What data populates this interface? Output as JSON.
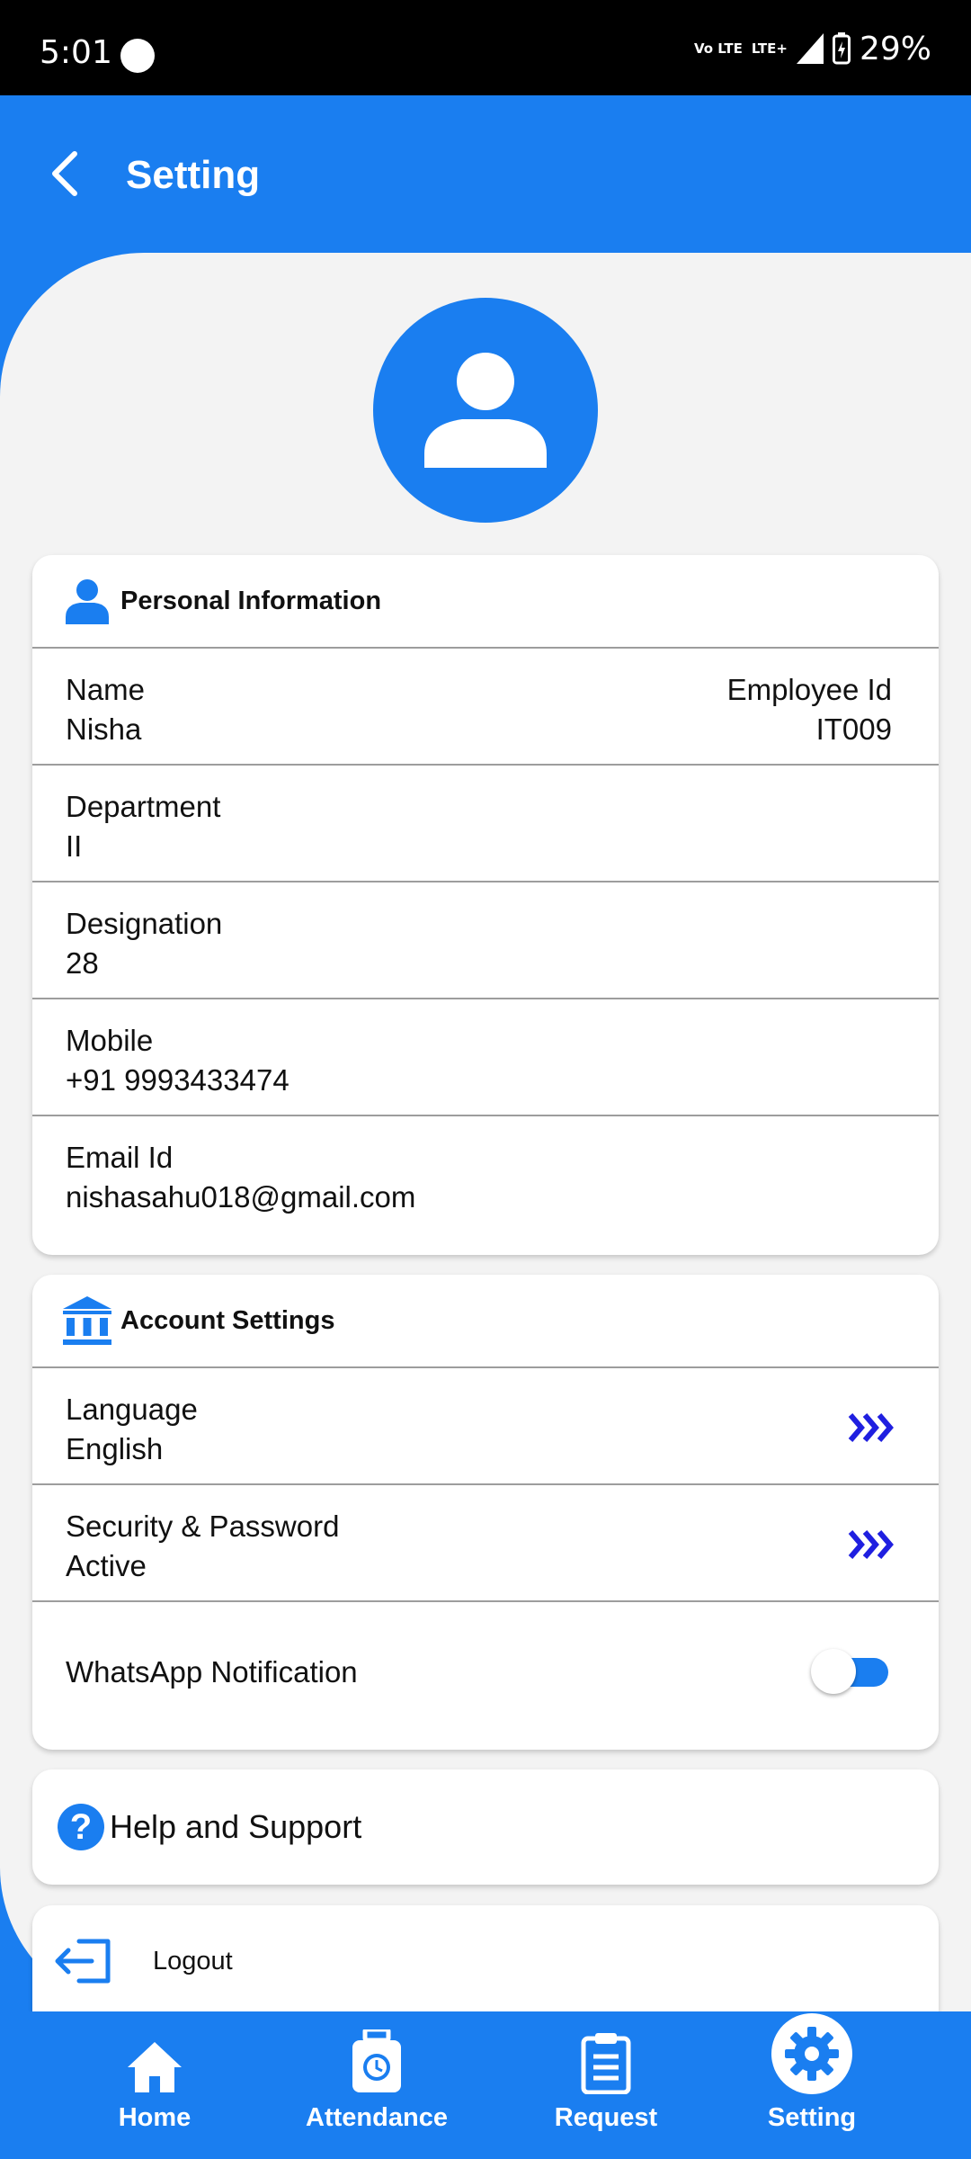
{
  "status_bar": {
    "time": "5:01",
    "network_volte": "Vo LTE",
    "network_lte": "LTE+",
    "battery": "29%"
  },
  "header": {
    "title": "Setting"
  },
  "personal_information": {
    "title": "Personal Information",
    "name_label": "Name",
    "name_value": "Nisha",
    "employee_id_label": "Employee Id",
    "employee_id_value": "IT009",
    "department_label": "Department",
    "department_value": "II",
    "designation_label": "Designation",
    "designation_value": "28",
    "mobile_label": "Mobile",
    "mobile_value": "+91 9993433474",
    "email_label": "Email Id",
    "email_value": "nishasahu018@gmail.com"
  },
  "account_settings": {
    "title": "Account Settings",
    "language_label": "Language",
    "language_value": "English",
    "security_label": "Security & Password",
    "security_value": "Active",
    "whatsapp_label": "WhatsApp Notification",
    "whatsapp_enabled": true
  },
  "help": {
    "label": "Help and Support"
  },
  "logout": {
    "label": "Logout"
  },
  "bottom_nav": {
    "items": [
      {
        "label": "Home",
        "icon": "home-icon"
      },
      {
        "label": "Attendance",
        "icon": "attendance-icon"
      },
      {
        "label": "Request",
        "icon": "clipboard-icon"
      },
      {
        "label": "Setting",
        "icon": "gear-icon",
        "active": true
      }
    ]
  },
  "colors": {
    "primary": "#1a7ef0",
    "background": "#f3f3f3",
    "chevron": "#1f1fe0"
  }
}
